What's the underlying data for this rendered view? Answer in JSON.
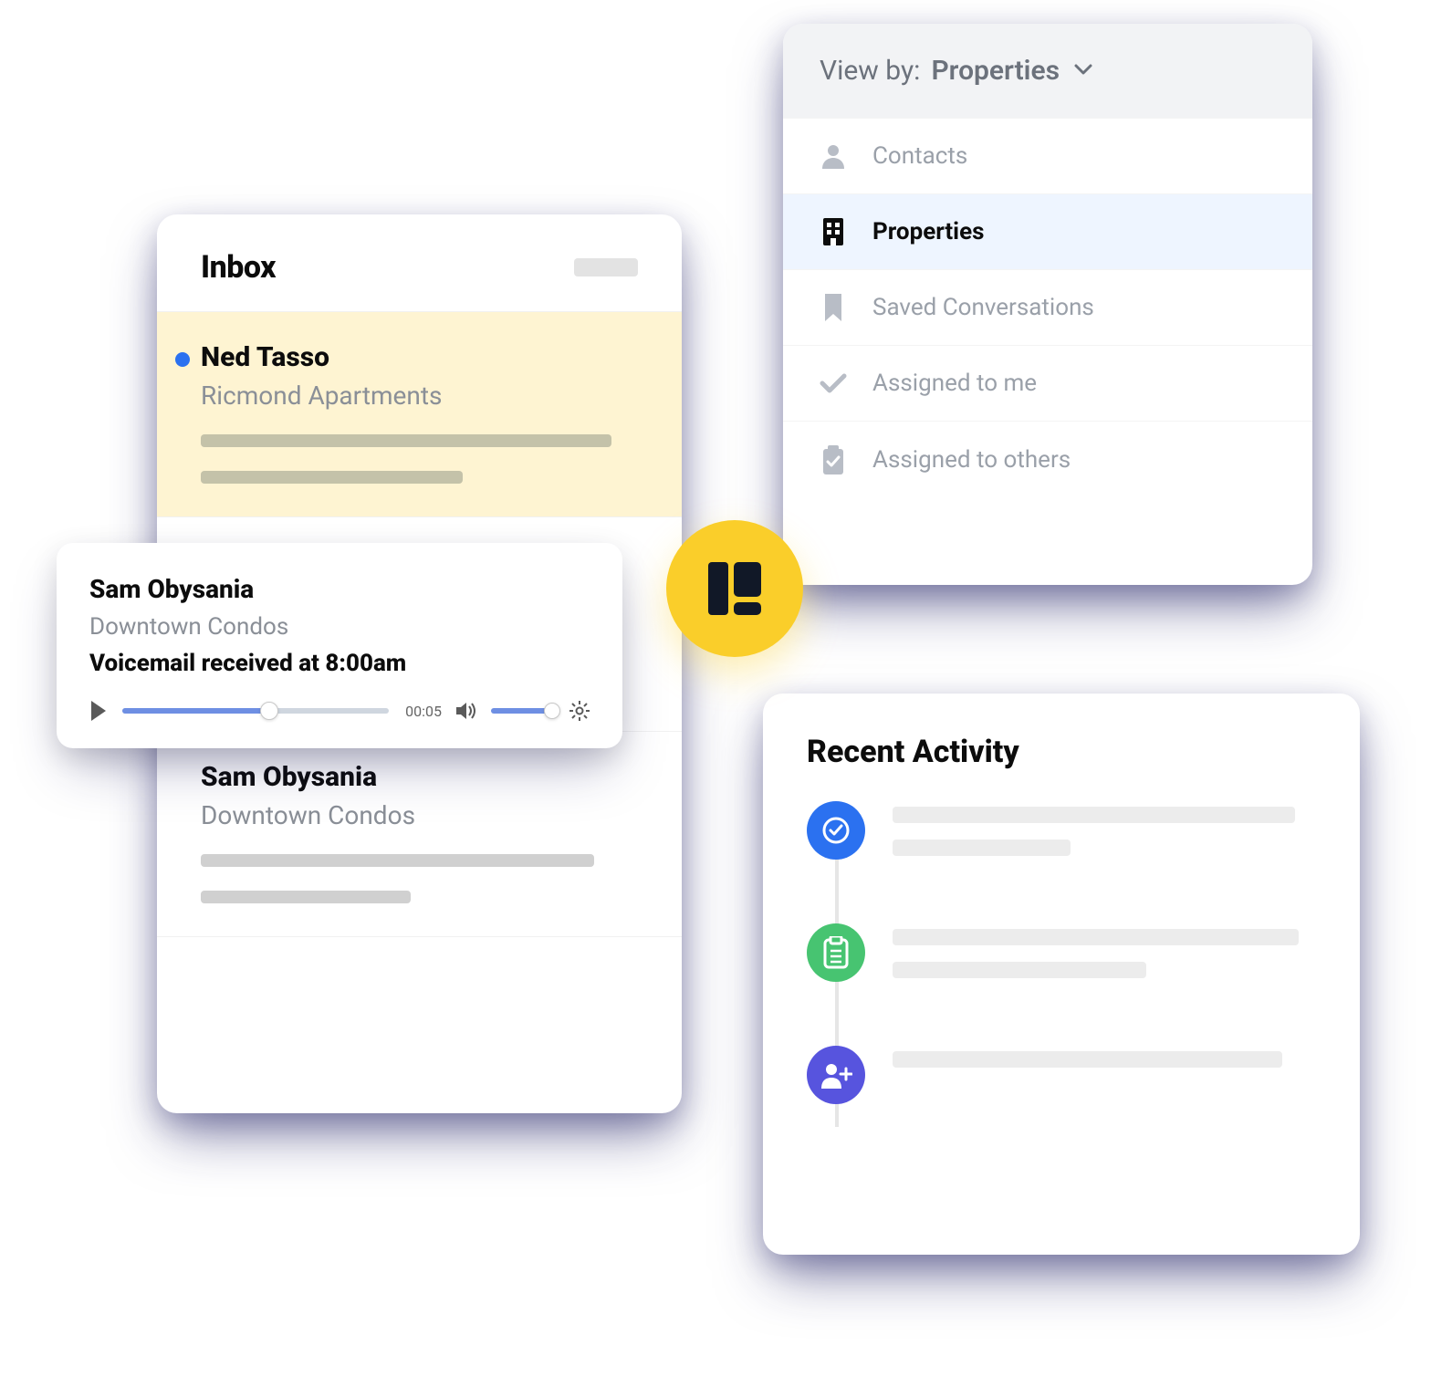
{
  "inbox": {
    "title": "Inbox",
    "items": [
      {
        "name": "Ned Tasso",
        "property": "Ricmond Apartments",
        "unread": true
      },
      {
        "name": "Sam Obysania",
        "property": "Downtown Condos",
        "unread": false
      }
    ]
  },
  "voicemail": {
    "name": "Sam Obysania",
    "property": "Downtown Condos",
    "title": "Voicemail received at 8:00am",
    "time": "00:05"
  },
  "filters": {
    "label": "View by:",
    "selected_value": "Properties",
    "items": [
      {
        "label": "Contacts",
        "icon": "person-icon"
      },
      {
        "label": "Properties",
        "icon": "building-icon",
        "selected": true
      },
      {
        "label": "Saved Conversations",
        "icon": "bookmark-icon"
      },
      {
        "label": "Assigned to me",
        "icon": "check-icon"
      },
      {
        "label": "Assigned to others",
        "icon": "clipboard-check-icon"
      }
    ]
  },
  "activity": {
    "title": "Recent Activity",
    "items": [
      {
        "icon": "check-circle-icon",
        "color": "blue"
      },
      {
        "icon": "clipboard-list-icon",
        "color": "green"
      },
      {
        "icon": "person-plus-icon",
        "color": "indigo"
      }
    ]
  },
  "colors": {
    "accent_blue": "#2B71F0",
    "accent_yellow": "#FACE2A",
    "accent_green": "#47C471",
    "accent_indigo": "#5754DE"
  }
}
